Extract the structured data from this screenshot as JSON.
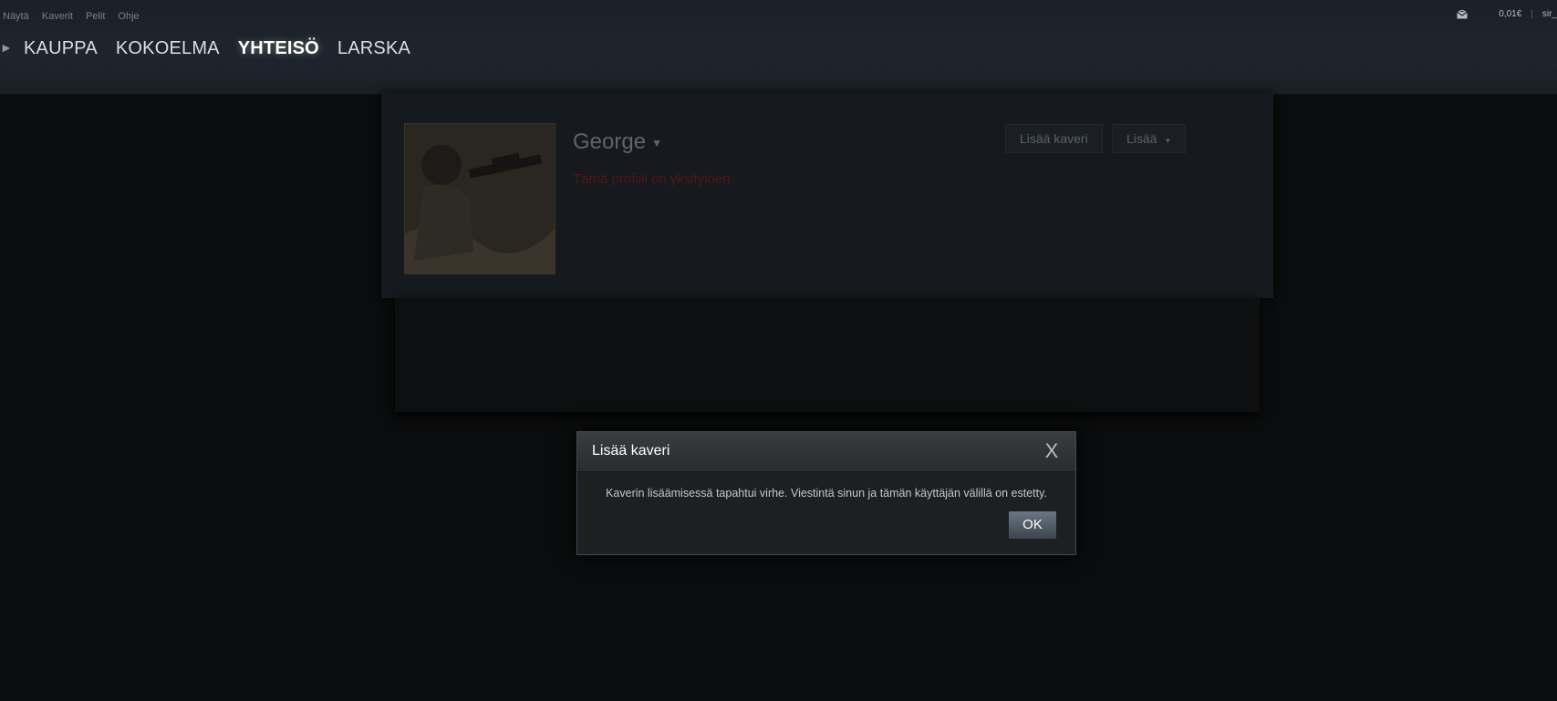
{
  "menu": {
    "items": [
      "Näytä",
      "Kaverit",
      "Pelit",
      "Ohje"
    ]
  },
  "nav": {
    "items": [
      "KAUPPA",
      "KOKOELMA",
      "YHTEISÖ",
      "LARSKA"
    ],
    "active_index": 2
  },
  "account": {
    "balance": "0,01€",
    "username": "sir_"
  },
  "profile": {
    "name": "George",
    "status": "Tämä profiili on yksityinen",
    "add_friend_label": "Lisää kaveri",
    "more_label": "Lisää"
  },
  "dialog": {
    "title": "Lisää kaveri",
    "message": "Kaverin lisäämisessä tapahtui virhe. Viestintä sinun ja tämän käyttäjän välillä on estetty.",
    "ok_label": "OK",
    "close_glyph": "X"
  },
  "colors": {
    "header_bg": "#1f252d",
    "accent_border": "#3c4b5a",
    "private_text": "#4a1a1a"
  }
}
